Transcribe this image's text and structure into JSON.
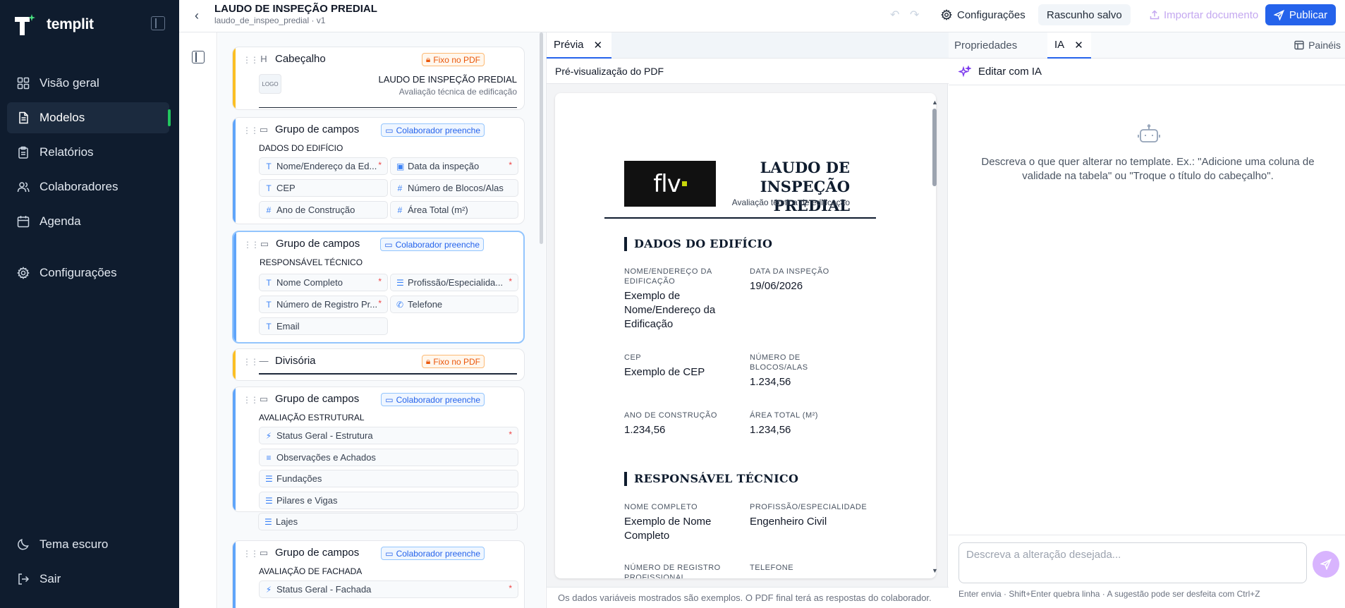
{
  "app": {
    "brand": "templit"
  },
  "sidebar": {
    "items": [
      {
        "label": "Visão geral",
        "icon": "grid-icon"
      },
      {
        "label": "Modelos",
        "icon": "file-icon",
        "active": true
      },
      {
        "label": "Relatórios",
        "icon": "clipboard-icon"
      },
      {
        "label": "Colaboradores",
        "icon": "users-icon"
      },
      {
        "label": "Agenda",
        "icon": "calendar-icon"
      },
      {
        "label": "Configurações",
        "icon": "gear-icon"
      }
    ],
    "bottom": [
      {
        "label": "Tema escuro",
        "icon": "moon-icon"
      },
      {
        "label": "Sair",
        "icon": "logout-icon"
      }
    ]
  },
  "topbar": {
    "title": "LAUDO DE INSPEÇÃO PREDIAL",
    "subtitle": "laudo_de_inspeo_predial · v1",
    "config_label": "Configurações",
    "draft_label": "Rascunho salvo",
    "import_label": "Importar documento",
    "publish_label": "Publicar"
  },
  "editor": {
    "header_card": {
      "type_label": "Cabeçalho",
      "badge": "Fixo no PDF",
      "logo_text": "LOGO",
      "title": "LAUDO DE INSPEÇÃO PREDIAL",
      "subtitle": "Avaliação técnica de edificação"
    },
    "group1": {
      "type_label": "Grupo de campos",
      "badge": "Colaborador preenche",
      "title": "DADOS DO EDIFÍCIO",
      "fields": [
        {
          "label": "Nome/Endereço da Ed...",
          "icon": "T",
          "required": true
        },
        {
          "label": "Data da inspeção",
          "icon": "cal",
          "required": true
        },
        {
          "label": "CEP",
          "icon": "T",
          "required": false
        },
        {
          "label": "Número de Blocos/Alas",
          "icon": "#",
          "required": false
        },
        {
          "label": "Ano de Construção",
          "icon": "#",
          "required": false
        },
        {
          "label": "Área Total (m²)",
          "icon": "#",
          "required": false
        }
      ]
    },
    "group2": {
      "type_label": "Grupo de campos",
      "badge": "Colaborador preenche",
      "title": "RESPONSÁVEL TÉCNICO",
      "fields": [
        {
          "label": "Nome Completo",
          "icon": "T",
          "required": true
        },
        {
          "label": "Profissão/Especialida...",
          "icon": "list",
          "required": true
        },
        {
          "label": "Número de Registro Pr...",
          "icon": "T",
          "required": true
        },
        {
          "label": "Telefone",
          "icon": "phone",
          "required": false
        },
        {
          "label": "Email",
          "icon": "T",
          "required": false
        }
      ]
    },
    "divider": {
      "type_label": "Divisória",
      "badge": "Fixo no PDF"
    },
    "group3": {
      "type_label": "Grupo de campos",
      "badge": "Colaborador preenche",
      "title": "AVALIAÇÃO ESTRUTURAL",
      "fields": [
        {
          "label": "Status Geral - Estrutura",
          "icon": "bolt",
          "required": true
        },
        {
          "label": "Observações e Achados",
          "icon": "text",
          "required": false
        },
        {
          "label": "Fundações",
          "icon": "list",
          "required": false
        },
        {
          "label": "Pilares e Vigas",
          "icon": "list",
          "required": false
        },
        {
          "label": "Lajes",
          "icon": "list",
          "required": false
        }
      ]
    },
    "group4": {
      "type_label": "Grupo de campos",
      "badge": "Colaborador preenche",
      "title": "AVALIAÇÃO DE FACHADA",
      "fields": [
        {
          "label": "Status Geral - Fachada",
          "icon": "bolt",
          "required": true
        }
      ]
    }
  },
  "preview": {
    "tab_label": "Prévia",
    "header": "Pré-visualização do PDF",
    "footer": "Os dados variáveis mostrados são exemplos. O PDF final terá as respostas do colaborador.",
    "doc": {
      "logo_text": "flv",
      "title": "LAUDO DE INSPEÇÃO PREDIAL",
      "subtitle": "Avaliação técnica de edificação",
      "sec1_title": "DADOS DO EDIFÍCIO",
      "sec1": [
        {
          "label": "NOME/ENDEREÇO DA EDIFICAÇÃO",
          "value": "Exemplo de Nome/Endereço da Edificação"
        },
        {
          "label": "DATA DA INSPEÇÃO",
          "value": "19/06/2026"
        },
        {
          "label": "CEP",
          "value": "Exemplo de CEP"
        },
        {
          "label": "NÚMERO DE BLOCOS/ALAS",
          "value": "1.234,56"
        },
        {
          "label": "ANO DE CONSTRUÇÃO",
          "value": "1.234,56"
        },
        {
          "label": "ÁREA TOTAL (M²)",
          "value": "1.234,56"
        }
      ],
      "sec2_title": "RESPONSÁVEL TÉCNICO",
      "sec2": [
        {
          "label": "NOME COMPLETO",
          "value": "Exemplo de Nome Completo"
        },
        {
          "label": "PROFISSÃO/ESPECIALIDADE",
          "value": "Engenheiro Civil"
        },
        {
          "label": "NÚMERO DE REGISTRO PROFISSIONAL",
          "value": ""
        },
        {
          "label": "TELEFONE",
          "value": ""
        }
      ]
    }
  },
  "right_panel": {
    "tab_props": "Propriedades",
    "tab_ia": "IA",
    "panels_label": "Painéis",
    "heading": "Editar com IA",
    "hint": "Descreva o que quer alterar no template. Ex.: \"Adicione uma coluna de validade na tabela\" ou \"Troque o título do cabeçalho\".",
    "input_placeholder": "Descreva a alteração desejada...",
    "keys_hint": "Enter envia · Shift+Enter quebra linha · A sugestão pode ser desfeita com Ctrl+Z"
  },
  "colors": {
    "sidebar_bg": "#0f1c2e",
    "accent": "#2563eb",
    "active_indicator": "#22c55e",
    "fixed_badge": "#ea580c",
    "collab_badge": "#2563eb"
  }
}
